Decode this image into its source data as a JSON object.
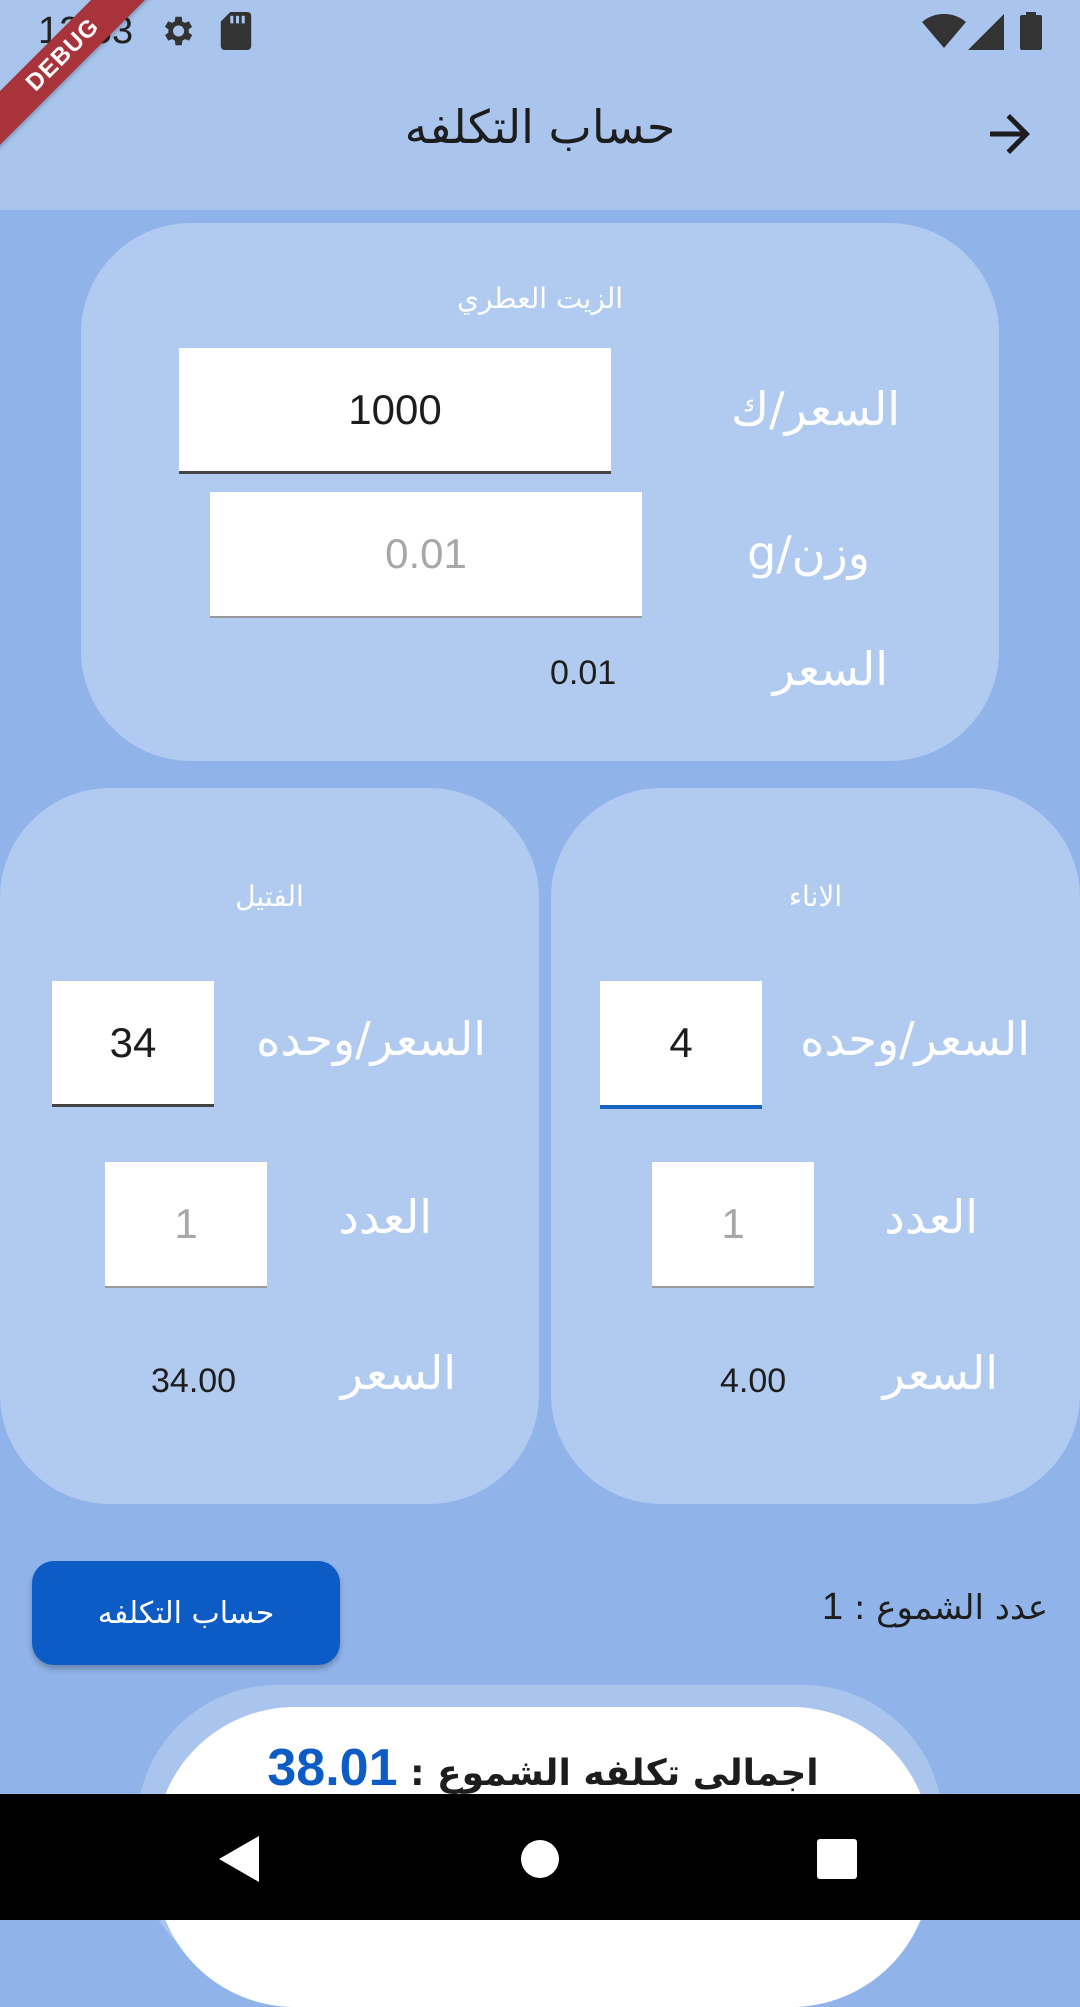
{
  "status_bar": {
    "time": "12:53"
  },
  "debug_banner": "DEBUG",
  "app_bar": {
    "title": "حساب التكلفه"
  },
  "oil_card": {
    "title": "الزيت العطري",
    "price_per_kg_label": "السعر/ك",
    "price_per_kg_value": "1000",
    "weight_label": "وزن/g",
    "weight_placeholder": "0.01",
    "price_label": "السعر",
    "price_value": "0.01"
  },
  "wick_card": {
    "title": "الفتيل",
    "unit_price_label": "السعر/وحده",
    "unit_price_value": "34",
    "count_label": "العدد",
    "count_placeholder": "1",
    "price_label": "السعر",
    "price_value": "34.00"
  },
  "container_card": {
    "title": "الاناء",
    "unit_price_label": "السعر/وحده",
    "unit_price_value": "4",
    "count_label": "العدد",
    "count_placeholder": "1",
    "price_label": "السعر",
    "price_value": "4.00"
  },
  "calculate_button": "حساب التكلفه",
  "candle_count": {
    "label": "عدد الشموع :",
    "value": "1"
  },
  "total": {
    "label": "اجمالى تكلفه الشموع :",
    "value": "38.01"
  },
  "colors": {
    "accent": "#0d5bc4",
    "background": "#90b4ea",
    "card": "#b1caf0",
    "app_bar": "#a9c5ee"
  }
}
